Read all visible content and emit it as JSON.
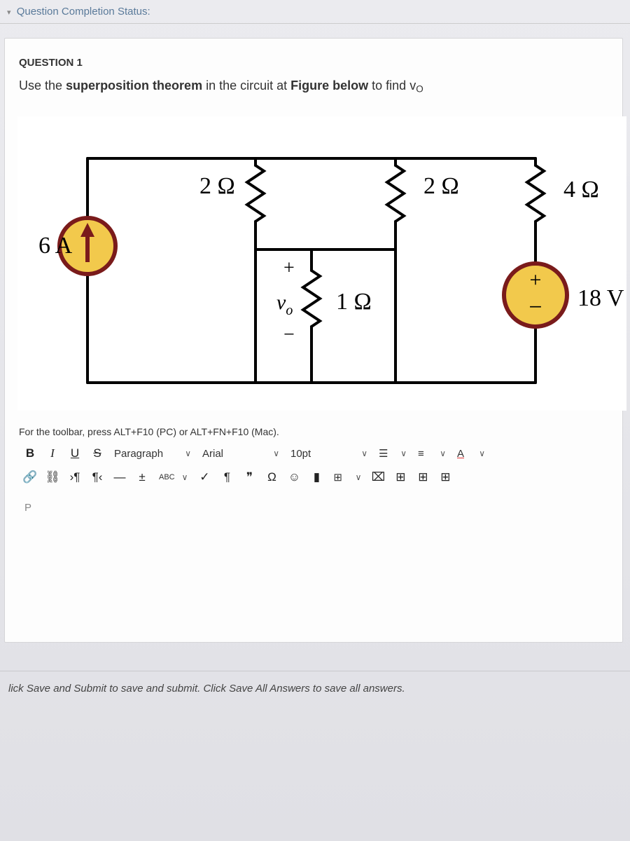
{
  "status_label": "Question Completion Status:",
  "question": {
    "heading": "QUESTION 1",
    "prompt_pre": "Use the ",
    "prompt_bold1": "superposition theorem",
    "prompt_mid": " in the circuit at ",
    "prompt_bold2": "Figure below",
    "prompt_post": "  to find v",
    "prompt_sub": "O"
  },
  "circuit": {
    "I_source": "6 A",
    "R_top_left": "2 Ω",
    "R_top_right": "2 Ω",
    "R_right": "4 Ω",
    "R_mid": "1 Ω",
    "V_label": "v",
    "V_sub": "o",
    "V_plus": "+",
    "V_minus": "−",
    "V_source": "18 V",
    "src_plus": "+",
    "src_minus": "−"
  },
  "toolbar": {
    "hint": "For the toolbar, press ALT+F10 (PC) or ALT+FN+F10 (Mac).",
    "bold": "B",
    "italic": "I",
    "underline": "U",
    "strike": "S",
    "style_select": "Paragraph",
    "font_select": "Arial",
    "size_select": "10pt",
    "abc": "ABC",
    "textcolor": "A"
  },
  "editor_placeholder": "P",
  "footer": "lick Save and Submit to save and submit. Click Save All Answers to save all answers."
}
